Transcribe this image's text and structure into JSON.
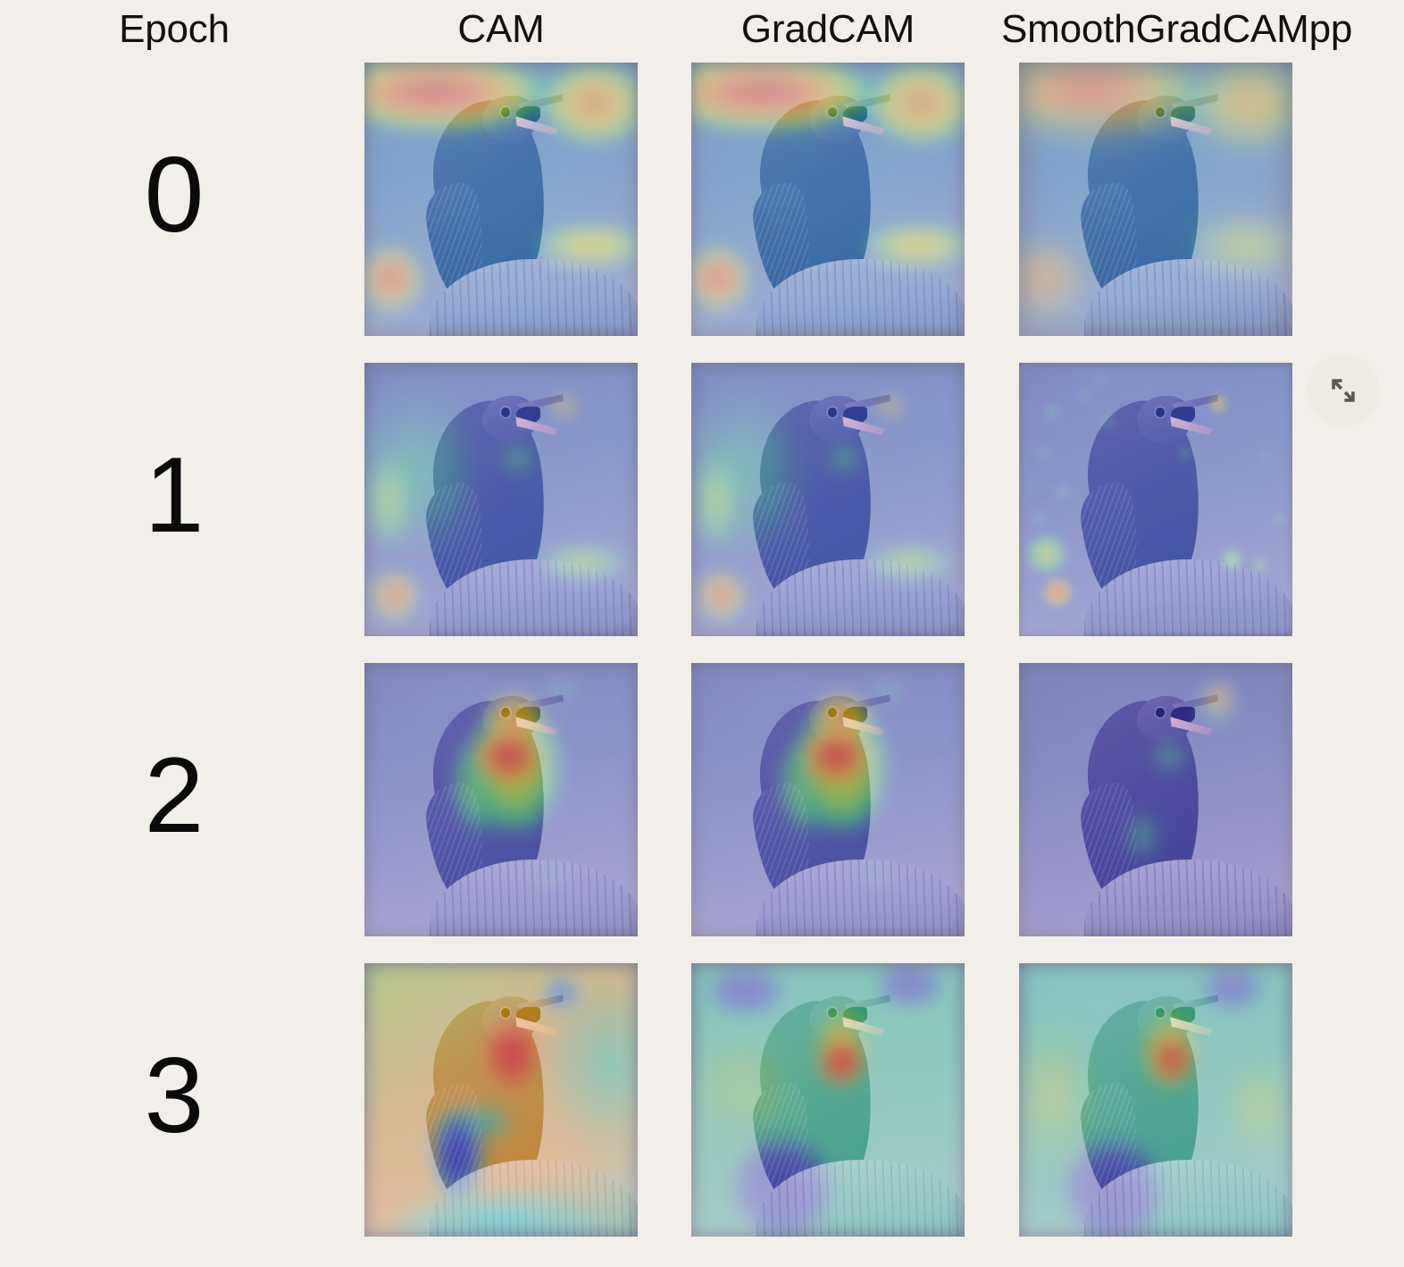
{
  "figure": {
    "row_header_label": "Epoch",
    "columns": [
      {
        "id": "cam",
        "label": "CAM"
      },
      {
        "id": "gradcam",
        "label": "GradCAM"
      },
      {
        "id": "smoothgradcampp",
        "label": "SmoothGradCAMpp"
      }
    ],
    "rows": [
      {
        "epoch": "0"
      },
      {
        "epoch": "1"
      },
      {
        "epoch": "2"
      },
      {
        "epoch": "3"
      }
    ],
    "background_color": "#f2efea",
    "text_color": "#111111",
    "subject": "perched singing starling on a wooden post",
    "colormap": "jet",
    "cells": [
      {
        "row": "0",
        "column": "CAM",
        "description": "Broad activation on the background: hot orange-red band across the top-left sky, an orange-yellow patch at the upper right, a red blob at the lower left corner and a yellow band at the lower right; the bird itself is cool blue-green."
      },
      {
        "row": "0",
        "column": "GradCAM",
        "description": "Nearly identical to CAM: orange-red top-left band, yellow upper-right patch, red lower-left blob, yellow lower-right band, bird in blue-green."
      },
      {
        "row": "0",
        "column": "SmoothGradCAMpp",
        "description": "Same coarse background pattern as CAM and GradCAM with slightly smoother orange-red and yellow regions."
      },
      {
        "row": "1",
        "column": "CAM",
        "description": "Mostly blue-violet with a green vertical band on the left, a saturated red blob at the lower-left edge, a small bright red spot near the beak at the upper right and a green-yellow smear at the lower right."
      },
      {
        "row": "1",
        "column": "GradCAM",
        "description": "Same structure as the CAM map for epoch 1: left green band with red lower-left blob, tiny red hotspot beside the beak, green-yellow region on the lower right."
      },
      {
        "row": "1",
        "column": "SmoothGradCAMpp",
        "description": "Noisy, speckled version of the epoch 1 map: mottled green-cyan texture over a blue field, red-orange blob at the lower left, red hotspot beside the beak and scattered green patches on the right."
      },
      {
        "row": "2",
        "column": "CAM",
        "description": "Activation collapses onto the bird: red-orange core over the head, throat and breast surrounded by a yellow-green halo, background is uniform blue-violet."
      },
      {
        "row": "2",
        "column": "GradCAM",
        "description": "Same as epoch 2 CAM: red-orange head and breast with a yellow-green contour around the bird, cool blue-violet background."
      },
      {
        "row": "2",
        "column": "SmoothGradCAMpp",
        "description": "Dark blue-violet almost everywhere with a single bright red-orange hotspot just above and right of the open beak, ringed by green."
      },
      {
        "row": "3",
        "column": "CAM",
        "description": "Background saturates to orange-yellow; the bird's head and breast are deep red, the wing and the post turn cyan, a small dark blue blob sits to the right of the beak."
      },
      {
        "row": "3",
        "column": "GradCAM",
        "description": "Green-teal background with a yellow-to-red focus on the head and throat of the bird, dark blue corners at the top and a blue-violet post."
      },
      {
        "row": "3",
        "column": "SmoothGradCAMpp",
        "description": "Teal-green background with a yellow-orange-red focus on the head and throat, blue-violet wing and post, blue patch at the top right."
      }
    ]
  },
  "controls": {
    "expand_button": {
      "icon": "expand-diagonal-arrows-icon",
      "tooltip": "Expand"
    }
  }
}
